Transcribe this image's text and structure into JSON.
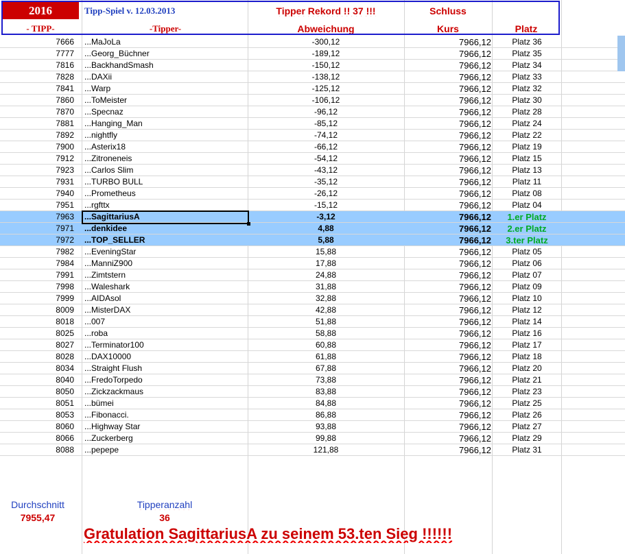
{
  "header": {
    "year": "2016",
    "game_title": "Tipp-Spiel v. 12.03.2013",
    "record": "Tipper Rekord !!  37  !!!",
    "schluss": "Schluss",
    "col_tipp": "- TIPP-",
    "col_tipper": "-Tipper-",
    "col_abw": "Abweichung",
    "col_kurs": "Kurs",
    "col_platz": "Platz"
  },
  "rows": [
    {
      "tipp": "7666",
      "name": "...MaJoLa",
      "abw": "-300,12",
      "kurs": "7966,12",
      "platz": "Platz 36"
    },
    {
      "tipp": "7777",
      "name": "...Georg_Büchner",
      "abw": "-189,12",
      "kurs": "7966,12",
      "platz": "Platz 35"
    },
    {
      "tipp": "7816",
      "name": "...BackhandSmash",
      "abw": "-150,12",
      "kurs": "7966,12",
      "platz": "Platz 34"
    },
    {
      "tipp": "7828",
      "name": "...DAXii",
      "abw": "-138,12",
      "kurs": "7966,12",
      "platz": "Platz 33"
    },
    {
      "tipp": "7841",
      "name": "...Warp",
      "abw": "-125,12",
      "kurs": "7966,12",
      "platz": "Platz 32"
    },
    {
      "tipp": "7860",
      "name": "...ToMeister",
      "abw": "-106,12",
      "kurs": "7966,12",
      "platz": "Platz 30"
    },
    {
      "tipp": "7870",
      "name": "...Specnaz",
      "abw": "-96,12",
      "kurs": "7966,12",
      "platz": "Platz 28"
    },
    {
      "tipp": "7881",
      "name": "...Hanging_Man",
      "abw": "-85,12",
      "kurs": "7966,12",
      "platz": "Platz 24"
    },
    {
      "tipp": "7892",
      "name": "...nightfly",
      "abw": "-74,12",
      "kurs": "7966,12",
      "platz": "Platz 22"
    },
    {
      "tipp": "7900",
      "name": "...Asterix18",
      "abw": "-66,12",
      "kurs": "7966,12",
      "platz": "Platz 19"
    },
    {
      "tipp": "7912",
      "name": "...Zitroneneis",
      "abw": "-54,12",
      "kurs": "7966,12",
      "platz": "Platz 15"
    },
    {
      "tipp": "7923",
      "name": "...Carlos Slim",
      "abw": "-43,12",
      "kurs": "7966,12",
      "platz": "Platz 13"
    },
    {
      "tipp": "7931",
      "name": "...TURBO BULL",
      "abw": "-35,12",
      "kurs": "7966,12",
      "platz": "Platz 11"
    },
    {
      "tipp": "7940",
      "name": "...Prometheus",
      "abw": "-26,12",
      "kurs": "7966,12",
      "platz": "Platz 08"
    },
    {
      "tipp": "7951",
      "name": "...rgfttx",
      "abw": "-15,12",
      "kurs": "7966,12",
      "platz": "Platz 04"
    },
    {
      "tipp": "7963",
      "name": "...SagittariusA",
      "abw": "-3,12",
      "kurs": "7966,12",
      "platz": "1.er Platz",
      "hl": true
    },
    {
      "tipp": "7971",
      "name": "...denkidee",
      "abw": "4,88",
      "kurs": "7966,12",
      "platz": "2.er Platz",
      "hl": true
    },
    {
      "tipp": "7972",
      "name": "...TOP_SELLER",
      "abw": "5,88",
      "kurs": "7966,12",
      "platz": "3.ter Platz",
      "hl": true
    },
    {
      "tipp": "7982",
      "name": "...EveningStar",
      "abw": "15,88",
      "kurs": "7966,12",
      "platz": "Platz 05"
    },
    {
      "tipp": "7984",
      "name": "...ManniZ900",
      "abw": "17,88",
      "kurs": "7966,12",
      "platz": "Platz 06"
    },
    {
      "tipp": "7991",
      "name": "...Zimtstern",
      "abw": "24,88",
      "kurs": "7966,12",
      "platz": "Platz 07"
    },
    {
      "tipp": "7998",
      "name": "...Waleshark",
      "abw": "31,88",
      "kurs": "7966,12",
      "platz": "Platz 09"
    },
    {
      "tipp": "7999",
      "name": "...AIDAsol",
      "abw": "32,88",
      "kurs": "7966,12",
      "platz": "Platz 10"
    },
    {
      "tipp": "8009",
      "name": "...MisterDAX",
      "abw": "42,88",
      "kurs": "7966,12",
      "platz": "Platz 12"
    },
    {
      "tipp": "8018",
      "name": "...007",
      "abw": "51,88",
      "kurs": "7966,12",
      "platz": "Platz 14"
    },
    {
      "tipp": "8025",
      "name": "...roba",
      "abw": "58,88",
      "kurs": "7966,12",
      "platz": "Platz 16"
    },
    {
      "tipp": "8027",
      "name": "...Terminator100",
      "abw": "60,88",
      "kurs": "7966,12",
      "platz": "Platz 17"
    },
    {
      "tipp": "8028",
      "name": "...DAX10000",
      "abw": "61,88",
      "kurs": "7966,12",
      "platz": "Platz 18"
    },
    {
      "tipp": "8034",
      "name": "...Straight Flush",
      "abw": "67,88",
      "kurs": "7966,12",
      "platz": "Platz 20"
    },
    {
      "tipp": "8040",
      "name": "...FredoTorpedo",
      "abw": "73,88",
      "kurs": "7966,12",
      "platz": "Platz 21"
    },
    {
      "tipp": "8050",
      "name": "...Zickzackmaus",
      "abw": "83,88",
      "kurs": "7966,12",
      "platz": "Platz 23"
    },
    {
      "tipp": "8051",
      "name": "...bümei",
      "abw": "84,88",
      "kurs": "7966,12",
      "platz": "Platz 25"
    },
    {
      "tipp": "8053",
      "name": "...Fibonacci.",
      "abw": "86,88",
      "kurs": "7966,12",
      "platz": "Platz 26"
    },
    {
      "tipp": "8060",
      "name": "...Highway Star",
      "abw": "93,88",
      "kurs": "7966,12",
      "platz": "Platz 27"
    },
    {
      "tipp": "8066",
      "name": "...Zuckerberg",
      "abw": "99,88",
      "kurs": "7966,12",
      "platz": "Platz 29"
    },
    {
      "tipp": "8088",
      "name": "...pepepe",
      "abw": "121,88",
      "kurs": "7966,12",
      "platz": "Platz 31"
    }
  ],
  "footer": {
    "avg_label": "Durchschnitt",
    "avg_value": "7955,47",
    "count_label": "Tipperanzahl",
    "count_value": "36",
    "congrats": "Gratulation SagittariusA  zu seinem 53.ten Sieg !!!!!!"
  },
  "colors": {
    "accent_red": "#cc0000",
    "accent_blue": "#1f3fbf",
    "highlight": "#99ccff",
    "green": "#00aa22"
  }
}
